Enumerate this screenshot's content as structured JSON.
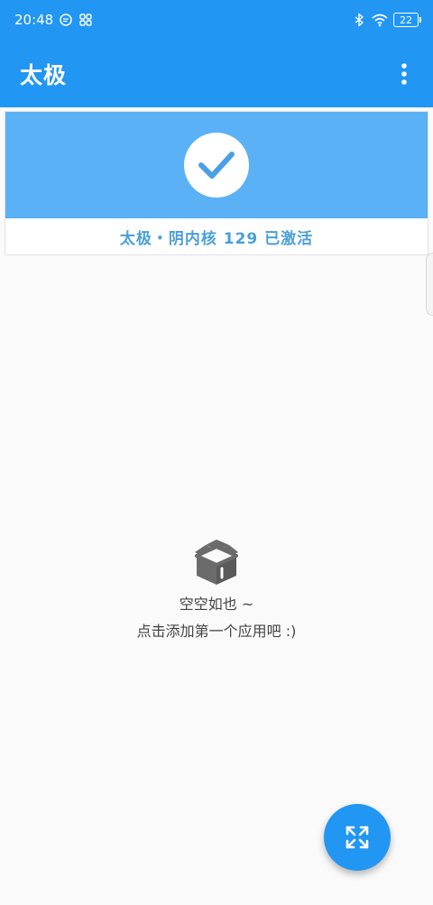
{
  "status_bar": {
    "time": "20:48",
    "battery": "22",
    "icons": [
      "chat-bubble-icon",
      "apps-grid-icon",
      "bluetooth-icon",
      "wifi-icon",
      "battery-icon"
    ]
  },
  "app_bar": {
    "title": "太极",
    "menu_icon": "more-vert-icon"
  },
  "status_card": {
    "icon": "check-icon",
    "text": "太极・阴内核 129 已激活"
  },
  "empty_state": {
    "icon": "open-box-icon",
    "title": "空空如也 ~",
    "subtitle": "点击添加第一个应用吧 :)"
  },
  "fab": {
    "icon": "expand-arrows-icon"
  },
  "colors": {
    "primary": "#2196f3",
    "banner": "#5ab1f5",
    "status_text": "#4a9fd8",
    "background": "#fafafa"
  }
}
